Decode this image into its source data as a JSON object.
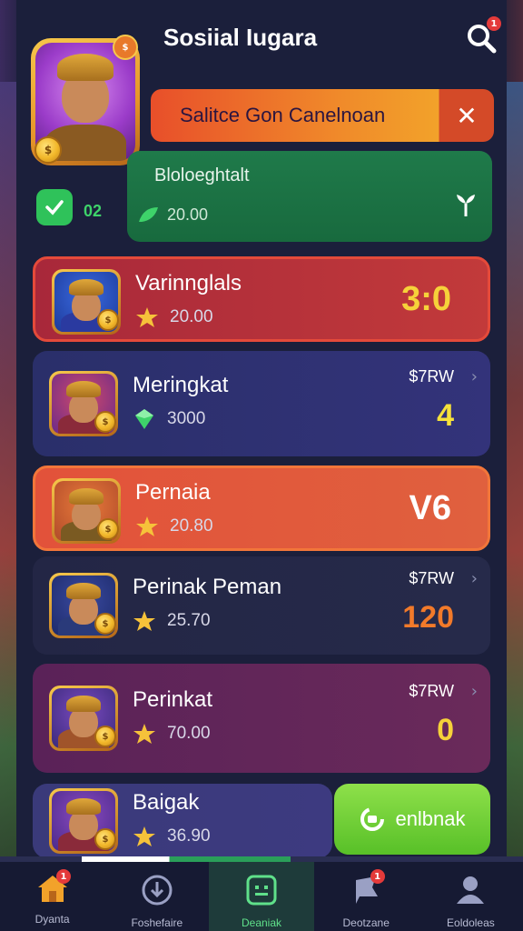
{
  "header": {
    "title": "Sosiial Iugara",
    "search_badge": "1"
  },
  "profile": {
    "avatar_coin": "$",
    "check_count": "02"
  },
  "promo": {
    "text": "Salitce Gon Canelnoan",
    "close_label": "✕"
  },
  "status": {
    "title": "Bloloeghtalt",
    "amount": "20.00"
  },
  "rows": [
    {
      "name": "Varinnglals",
      "points": "20.00",
      "price": "",
      "score": "3:0",
      "score_color": "#f6d23a",
      "bg": "linear-gradient(90deg,#a8283a 0%,#c23a3a 100%)",
      "border": "#e44a3a",
      "icon": "star-icon"
    },
    {
      "name": "Meringkat",
      "points": "3000",
      "price": "$7RW",
      "score": "4",
      "score_color": "#f6e23a",
      "bg": "linear-gradient(90deg,#2a2f6a 0%,#33337a 100%)",
      "border": "none",
      "icon": "gem-icon"
    },
    {
      "name": "Pernaia",
      "points": "20.80",
      "price": "",
      "score": "V6",
      "score_color": "#ffffff",
      "bg": "linear-gradient(90deg,#e2523a 0%,#e0603e 100%)",
      "border": "#f2763a",
      "icon": "star-icon"
    },
    {
      "name": "Perinak Peman",
      "points": "25.70",
      "price": "$7RW",
      "score": "120",
      "score_color": "#f27a2a",
      "bg": "linear-gradient(90deg,#232645 0%,#262a4a 100%)",
      "border": "none",
      "icon": "star-icon"
    },
    {
      "name": "Perinkat",
      "points": "70.00",
      "price": "$7RW",
      "score": "0",
      "score_color": "#f6d23a",
      "bg": "linear-gradient(90deg,#5a2258 0%,#6a2a5a 100%)",
      "border": "none",
      "icon": "star-icon"
    },
    {
      "name": "Baigak",
      "points": "36.90",
      "price": "",
      "score": "",
      "score_color": "#ffffff",
      "bg": "linear-gradient(90deg,#3a3a7a 0%,#3d3a80 100%)",
      "border": "none",
      "icon": "star-icon"
    }
  ],
  "cta": {
    "label": "enlbnak"
  },
  "nav": [
    {
      "label": "Dyanta",
      "icon": "home-icon",
      "badge": "1"
    },
    {
      "label": "Foshefaire",
      "icon": "download-icon",
      "badge": ""
    },
    {
      "label": "Deaniak",
      "icon": "game-icon",
      "badge": ""
    },
    {
      "label": "Deotzane",
      "icon": "flag-icon",
      "badge": "1"
    },
    {
      "label": "Eoldoleas",
      "icon": "profile-icon",
      "badge": ""
    }
  ],
  "progress": {
    "active_tab_index": 2
  }
}
